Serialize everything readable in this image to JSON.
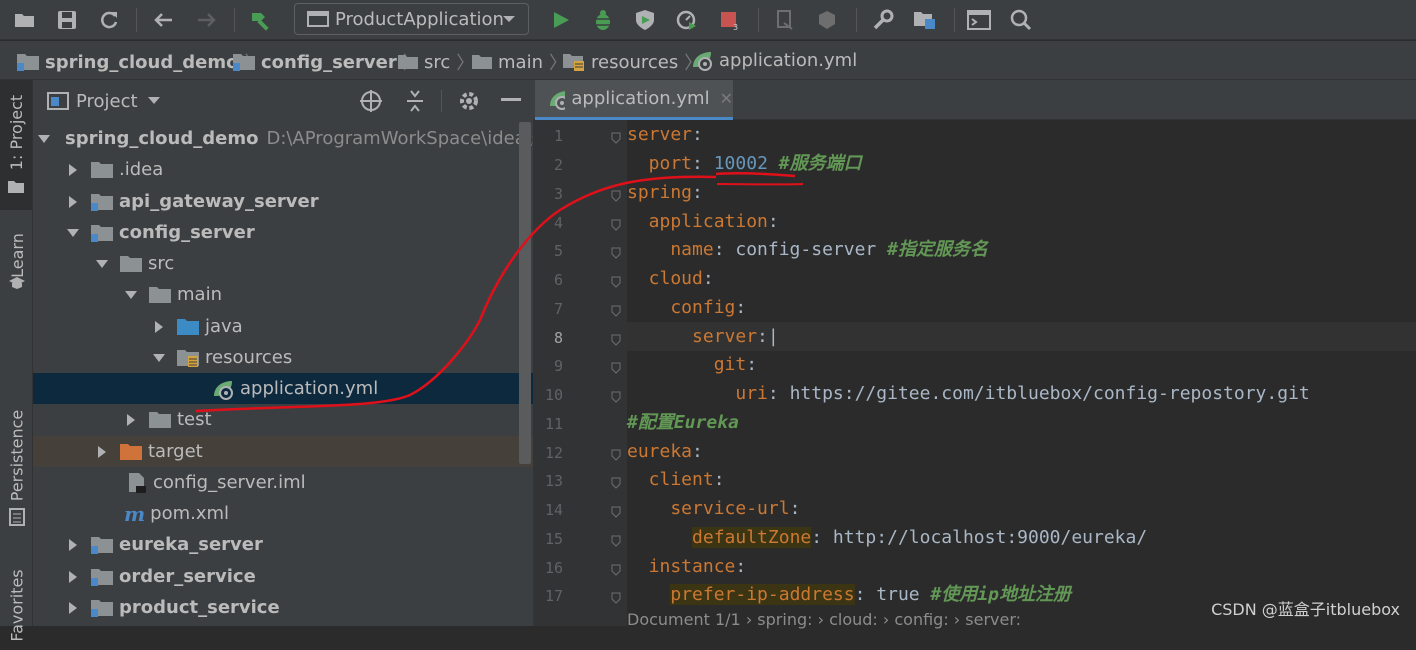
{
  "toolbar": {
    "run_config": "ProductApplication",
    "icons": [
      "open-icon",
      "save-icon",
      "sync-icon",
      "back-icon",
      "forward-icon",
      "build-icon",
      "run-icon",
      "debug-icon",
      "coverage-icon",
      "profile-icon",
      "stop-icon",
      "attach-icon",
      "database-icon",
      "settings-icon",
      "project-structure-icon",
      "terminal-icon",
      "search-icon"
    ]
  },
  "breadcrumb": {
    "items": [
      "spring_cloud_demo",
      "config_server",
      "src",
      "main",
      "resources",
      "application.yml"
    ]
  },
  "left_strip": {
    "project_tab": "1: Project",
    "learn_tab": "Learn",
    "persistence_tab": "Persistence",
    "favorites_tab": "Favorites"
  },
  "project_panel": {
    "title": "Project",
    "tree": [
      {
        "label": "spring_cloud_demo",
        "path": "D:\\AProgramWorkSpace\\idea\\sp",
        "level": 0,
        "open": true,
        "bold": true,
        "icon": "module"
      },
      {
        "label": ".idea",
        "level": 1,
        "open": false,
        "icon": "folder"
      },
      {
        "label": "api_gateway_server",
        "level": 1,
        "open": false,
        "bold": true,
        "icon": "module"
      },
      {
        "label": "config_server",
        "level": 1,
        "open": true,
        "bold": true,
        "icon": "module"
      },
      {
        "label": "src",
        "level": 2,
        "open": true,
        "icon": "folder"
      },
      {
        "label": "main",
        "level": 3,
        "open": true,
        "icon": "folder"
      },
      {
        "label": "java",
        "level": 4,
        "open": false,
        "icon": "source-folder"
      },
      {
        "label": "resources",
        "level": 4,
        "open": true,
        "icon": "resources-folder"
      },
      {
        "label": "application.yml",
        "level": 5,
        "icon": "spring-yml",
        "selected": true
      },
      {
        "label": "test",
        "level": 3,
        "open": false,
        "icon": "folder"
      },
      {
        "label": "target",
        "level": 2,
        "open": false,
        "icon": "target-folder",
        "highlight": true
      },
      {
        "label": "config_server.iml",
        "level": 2,
        "icon": "iml"
      },
      {
        "label": "pom.xml",
        "level": 2,
        "icon": "maven"
      },
      {
        "label": "eureka_server",
        "level": 1,
        "open": false,
        "bold": true,
        "icon": "module"
      },
      {
        "label": "order_service",
        "level": 1,
        "open": false,
        "bold": true,
        "icon": "module"
      },
      {
        "label": "product_service",
        "level": 1,
        "open": false,
        "bold": true,
        "icon": "module"
      }
    ]
  },
  "editor": {
    "tab_label": "application.yml",
    "line_numbers": [
      "1",
      "2",
      "3",
      "4",
      "5",
      "6",
      "7",
      "8",
      "9",
      "10",
      "11",
      "12",
      "13",
      "14",
      "15",
      "16",
      "17"
    ],
    "lines": [
      [
        {
          "t": "server",
          "s": "k"
        },
        {
          "t": ":",
          "s": "p"
        }
      ],
      [
        {
          "t": "  port",
          "s": "k"
        },
        {
          "t": ": ",
          "s": "p"
        },
        {
          "t": "10002",
          "s": "n"
        },
        {
          "t": " #服务端口",
          "s": "c"
        }
      ],
      [
        {
          "t": "spring",
          "s": "k"
        },
        {
          "t": ":",
          "s": "p"
        }
      ],
      [
        {
          "t": "  application",
          "s": "k"
        },
        {
          "t": ":",
          "s": "p"
        }
      ],
      [
        {
          "t": "    name",
          "s": "k"
        },
        {
          "t": ": config-server",
          "s": "v"
        },
        {
          "t": " #指定服务名",
          "s": "c"
        }
      ],
      [
        {
          "t": "  cloud",
          "s": "k"
        },
        {
          "t": ":",
          "s": "p"
        }
      ],
      [
        {
          "t": "    config",
          "s": "k"
        },
        {
          "t": ":",
          "s": "p"
        }
      ],
      [
        {
          "t": "      server",
          "s": "k"
        },
        {
          "t": ":",
          "s": "p"
        },
        {
          "t": "|",
          "s": "p"
        }
      ],
      [
        {
          "t": "        git",
          "s": "k"
        },
        {
          "t": ":",
          "s": "p"
        }
      ],
      [
        {
          "t": "          uri",
          "s": "k"
        },
        {
          "t": ": https://gitee.com/itbluebox/config-repostory.git",
          "s": "v"
        }
      ],
      [
        {
          "t": "#配置Eureka",
          "s": "c"
        }
      ],
      [
        {
          "t": "eureka",
          "s": "k"
        },
        {
          "t": ":",
          "s": "p"
        }
      ],
      [
        {
          "t": "  client",
          "s": "k"
        },
        {
          "t": ":",
          "s": "p"
        }
      ],
      [
        {
          "t": "    service-url",
          "s": "k"
        },
        {
          "t": ":",
          "s": "p"
        }
      ],
      [
        {
          "t": "      ",
          "s": "p"
        },
        {
          "t": "defaultZone",
          "s": "k",
          "hl": true
        },
        {
          "t": ": http://localhost:9000/eureka/",
          "s": "v"
        }
      ],
      [
        {
          "t": "  instance",
          "s": "k"
        },
        {
          "t": ":",
          "s": "p"
        }
      ],
      [
        {
          "t": "    ",
          "s": "p"
        },
        {
          "t": "prefer-ip-address",
          "s": "k",
          "hl": true
        },
        {
          "t": ": true ",
          "s": "v"
        },
        {
          "t": "#使用ip地址注册",
          "s": "c"
        }
      ]
    ],
    "status_path": "Document 1/1   ›  spring:  ›  cloud:  ›  config:  ›  server:"
  },
  "watermark": "CSDN @蓝盒子itbluebox",
  "colors": {
    "keyword": "#cc7832",
    "number": "#6897bb",
    "comment": "#629755",
    "selection": "#0d293e",
    "annotation": "#e0101a"
  }
}
